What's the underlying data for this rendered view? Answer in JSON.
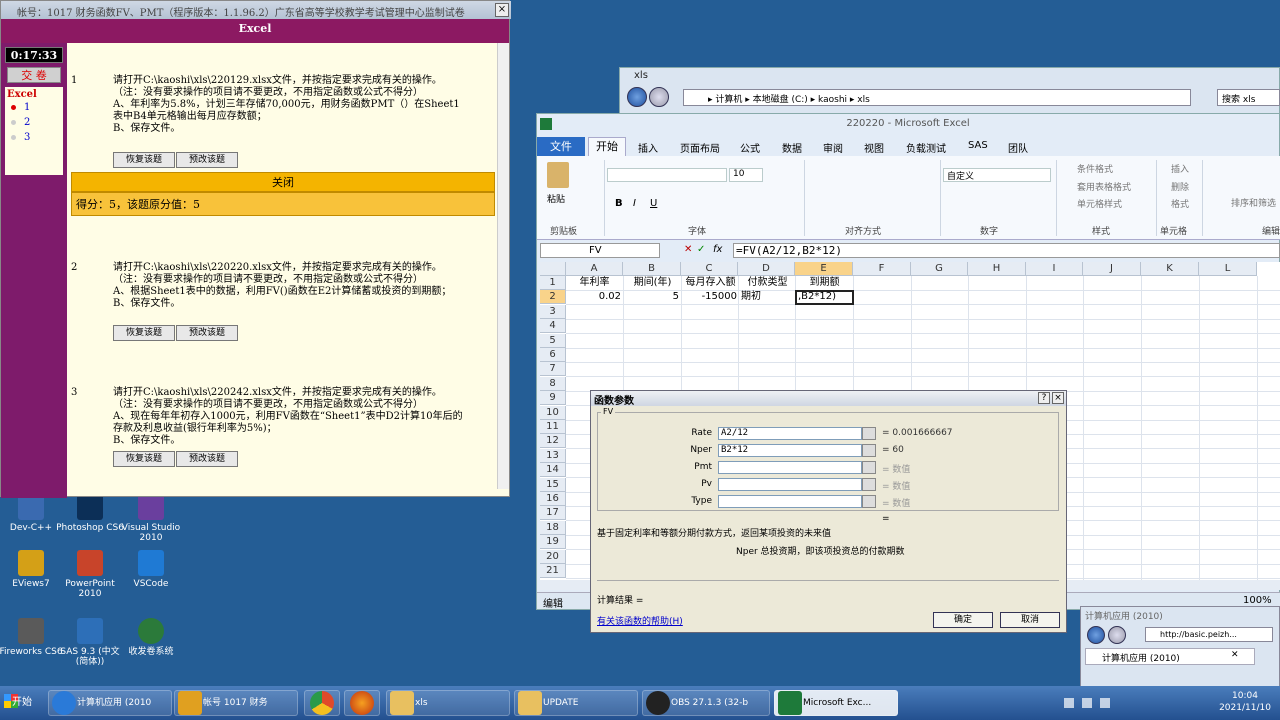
{
  "exam": {
    "title": "帐号：1017  财务函数FV、PMT（程序版本：1.1.96.2）广东省高等学校教学考试管理中心监制试卷",
    "close_x": "×",
    "header": "Excel",
    "timer": "0:17:33",
    "submit": "交 卷",
    "side_title": "Excel",
    "side_items": [
      "1",
      "2",
      "3"
    ],
    "questions": [
      {
        "num": "1",
        "text": "请打开C:\\kaoshi\\xls\\220129.xlsx文件，并按指定要求完成有关的操作。\n（注：没有要求操作的项目请不要更改，不用指定函数或公式不得分）\nA、年利率为5.8%，计划三年存储70,000元，用财务函数PMT（）在Sheet1\n表中B4单元格输出每月应存数额；\nB、保存文件。",
        "restore": "恢复该题",
        "preview": "预改该题"
      },
      {
        "num": "2",
        "text": "请打开C:\\kaoshi\\xls\\220220.xlsx文件，并按指定要求完成有关的操作。\n（注：没有要求操作的项目请不要更改，不用指定函数或公式不得分）\nA、根据Sheet1表中的数据，利用FV()函数在E2计算储蓄或投资的到期额；\nB、保存文件。",
        "restore": "恢复该题",
        "preview": "预改该题"
      },
      {
        "num": "3",
        "text": "请打开C:\\kaoshi\\xls\\220242.xlsx文件，并按指定要求完成有关的操作。\n（注：没有要求操作的项目请不要更改，不用指定函数或公式不得分）\nA、现在每年年初存入1000元，利用FV函数在“Sheet1”表中D2计算10年后的\n存款及利息收益(银行年利率为5%)；\nB、保存文件。",
        "restore": "恢复该题",
        "preview": "预改该题"
      }
    ],
    "close_label": "关闭",
    "score": "得分：5，该题原分值：5"
  },
  "desktop": {
    "icons": [
      {
        "label": "Dev-C++",
        "color": "#3a6ab0"
      },
      {
        "label": "Photoshop CS6",
        "color": "#0c2f57"
      },
      {
        "label": "Visual Studio 2010",
        "color": "#6a3f9e"
      },
      {
        "label": "EViews7",
        "color": "#d4a017"
      },
      {
        "label": "PowerPoint 2010",
        "color": "#c8442a"
      },
      {
        "label": "VSCode",
        "color": "#1f7ad4"
      },
      {
        "label": "Fireworks CS6",
        "color": "#5a5a5a"
      },
      {
        "label": "SAS 9.3 (中文(简体))",
        "color": "#2d6fb8"
      },
      {
        "label": "收发卷系统",
        "color": "#2b7a3a"
      }
    ]
  },
  "explorer": {
    "title": "xls",
    "path": "▸ 计算机 ▸ 本地磁盘 (C:) ▸ kaoshi ▸ xls",
    "search": "搜索 xls"
  },
  "excel": {
    "title": "220220 - Microsoft Excel",
    "tabs": [
      "文件",
      "开始",
      "插入",
      "页面布局",
      "公式",
      "数据",
      "审阅",
      "视图",
      "负载测试",
      "SAS",
      "团队"
    ],
    "groups": [
      "剪贴板",
      "字体",
      "对齐方式",
      "数字",
      "样式",
      "单元格",
      "编辑"
    ],
    "paste": "粘贴",
    "font_size": "10",
    "number_format": "自定义",
    "styles": [
      "条件格式",
      "套用表格格式",
      "单元格样式"
    ],
    "cells_cmds": [
      "插入",
      "删除",
      "格式"
    ],
    "edit_cmd": "排序和筛选",
    "name_box": "FV",
    "formula": "=FV(A2/12,B2*12)",
    "columns": [
      "A",
      "B",
      "C",
      "D",
      "E",
      "F",
      "G",
      "H",
      "I",
      "J",
      "K",
      "L"
    ],
    "rows": [
      "1",
      "2",
      "3",
      "4",
      "5",
      "6",
      "7",
      "8",
      "9",
      "10",
      "11",
      "12",
      "13",
      "14",
      "15",
      "16",
      "17",
      "18",
      "19",
      "20",
      "21"
    ],
    "cells": {
      "A1": "年利率",
      "B1": "期间(年)",
      "C1": "每月存入额",
      "D1": "付款类型",
      "E1": "到期额",
      "A2": "0.02",
      "B2": "5",
      "C2": "-15000",
      "D2": "期初",
      "E2": ",B2*12)"
    },
    "status": "编辑",
    "zoom": "100%"
  },
  "dialog": {
    "title": "函数参数",
    "help_btn": "?",
    "close_btn": "×",
    "group": "FV",
    "args": [
      {
        "label": "Rate",
        "value": "A2/12",
        "result": "= 0.001666667"
      },
      {
        "label": "Nper",
        "value": "B2*12",
        "result": "= 60"
      },
      {
        "label": "Pmt",
        "value": "",
        "result": "= 数值"
      },
      {
        "label": "Pv",
        "value": "",
        "result": "= 数值"
      },
      {
        "label": "Type",
        "value": "",
        "result": "= 数值"
      }
    ],
    "eq": "=",
    "description": "基于固定利率和等额分期付款方式，返回某项投资的未来值",
    "arg_desc": "Nper  总投资期，即该项投资总的付款期数",
    "result_label": "计算结果 =",
    "help_link": "有关该函数的帮助(H)",
    "ok": "确定",
    "cancel": "取消"
  },
  "browser": {
    "title": "计算机应用 (2010)",
    "url": "http://basic.peizh..."
  },
  "taskbar": {
    "start": "开始",
    "tasks": [
      {
        "label": "计算机应用 (2010",
        "color": "#2a7ad8"
      },
      {
        "label": "帐号 1017  财务",
        "color": "#e0a020"
      },
      {
        "label": "",
        "color": "#e04a2a"
      },
      {
        "label": "",
        "color": "#e06a10"
      },
      {
        "label": "xls",
        "color": "#e8c060"
      },
      {
        "label": "UPDATE",
        "color": "#e8c060"
      },
      {
        "label": "OBS 27.1.3 (32-b",
        "color": "#222222"
      },
      {
        "label": "Microsoft Exc...",
        "color": "#1e7a3a"
      }
    ],
    "time": "10:04",
    "date": "2021/11/10"
  }
}
